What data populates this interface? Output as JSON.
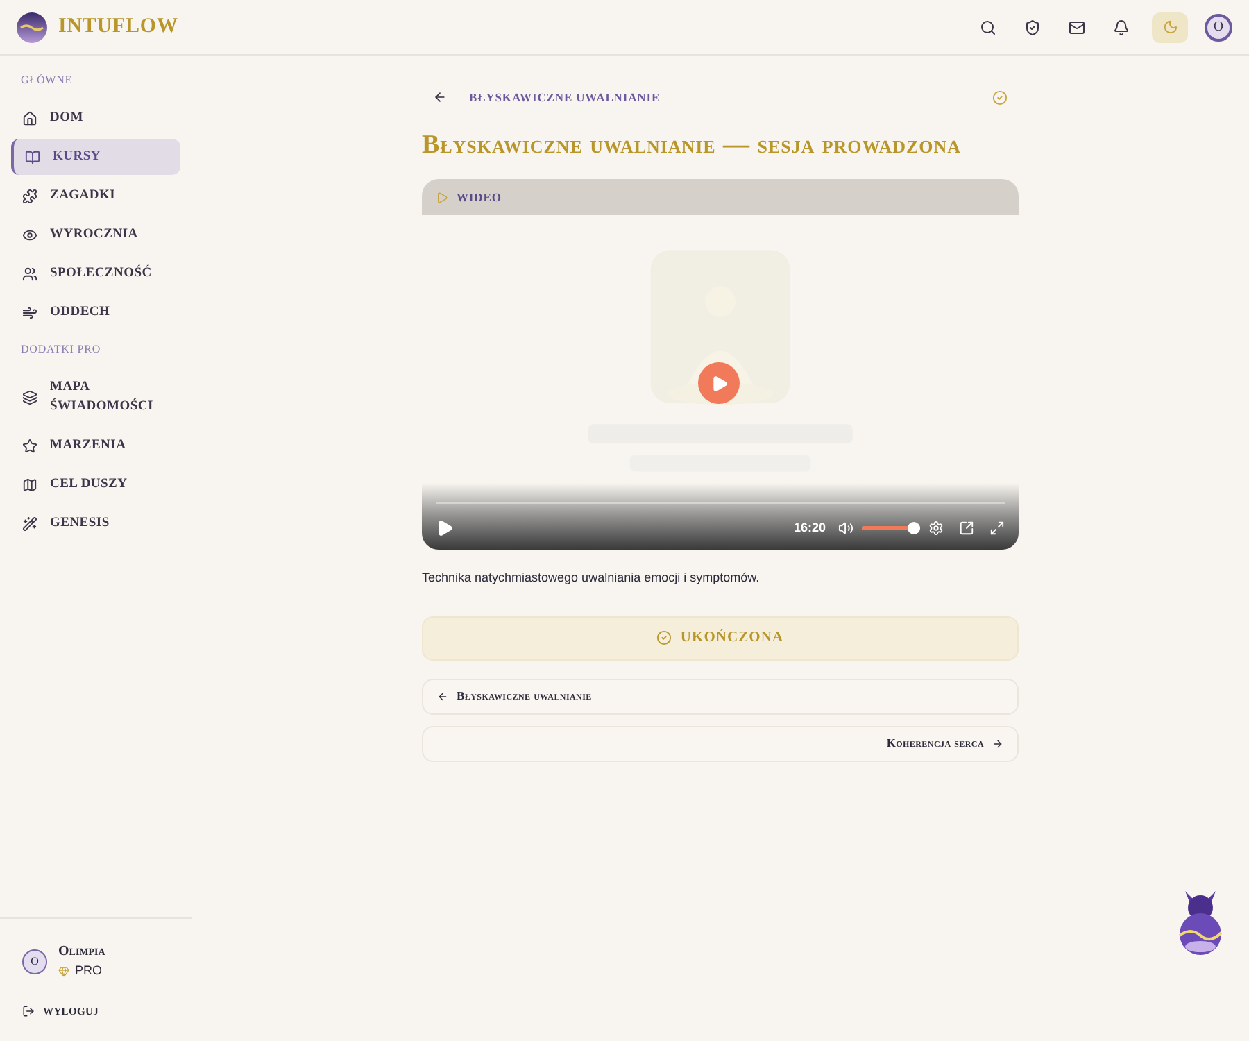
{
  "brand": {
    "name": "INTUFLOW"
  },
  "header": {
    "theme_toggle": {
      "on": true
    },
    "avatar": "O"
  },
  "sidebar": {
    "sections": [
      {
        "title": "GŁÓWNE",
        "items": [
          {
            "label": "DOM",
            "selected": false
          },
          {
            "label": "KURSY",
            "selected": true
          },
          {
            "label": "ZAGADKI",
            "selected": false
          },
          {
            "label": "WYROCZNIA",
            "selected": false
          },
          {
            "label": "SPOŁECZNOŚĆ",
            "selected": false
          },
          {
            "label": "ODDECH",
            "selected": false
          }
        ]
      },
      {
        "title": "DODATKI PRO",
        "items": [
          {
            "label": "MAPA ŚWIADOMOŚCI",
            "selected": false
          },
          {
            "label": "MARZENIA",
            "selected": false
          },
          {
            "label": "CEL DUSZY",
            "selected": false
          },
          {
            "label": "GENESIS",
            "selected": false
          }
        ]
      }
    ],
    "user": {
      "avatar": "O",
      "name": "Olimpia",
      "plan": "PRO"
    },
    "logout": "WYLOGUJ"
  },
  "breadcrumb": {
    "label": "BŁYSKAWICZNE UWALNIANIE",
    "completed": true
  },
  "title": "Błyskawiczne uwalnianie — sesja prowadzona",
  "video": {
    "tab": "WIDEO",
    "time": "16:20",
    "volume": {
      "level": 1
    }
  },
  "description": "Technika natychmiastowego uwalniania emocji i symptomów.",
  "complete_button": {
    "label": "UKOŃCZONA",
    "completed": true
  },
  "nav": [
    {
      "kind": "prev",
      "label": "Błyskawiczne uwalnianie"
    },
    {
      "kind": "next",
      "label": "Koherencja serca"
    }
  ]
}
